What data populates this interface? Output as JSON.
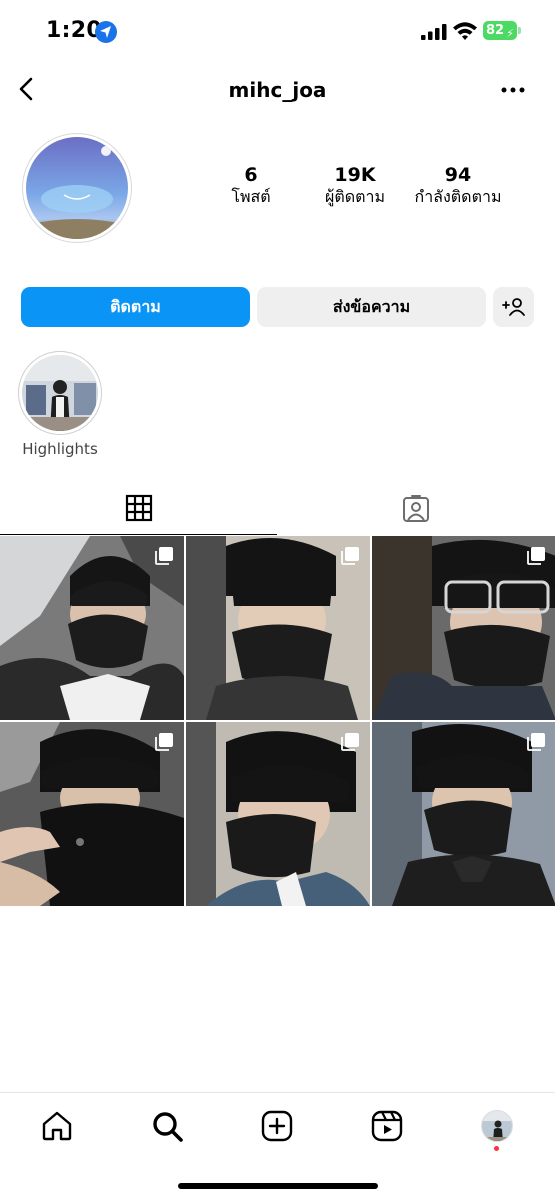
{
  "status_bar": {
    "time": "1:20",
    "battery": "82",
    "icons": [
      "location-arrow-icon",
      "cell-signal-icon",
      "wifi-icon",
      "battery-charging-icon"
    ]
  },
  "header": {
    "username": "mihc_joa",
    "back_icon": "chevron-left-icon",
    "more_icon": "more-horizontal-icon"
  },
  "profile": {
    "stats": [
      {
        "value": "6",
        "label": "โพสต์"
      },
      {
        "value": "19K",
        "label": "ผู้ติดตาม"
      },
      {
        "value": "94",
        "label": "กำลังติดตาม"
      }
    ]
  },
  "actions": {
    "follow_label": "ติดตาม",
    "message_label": "ส่งข้อความ",
    "suggest_icon": "add-person-icon"
  },
  "highlights": [
    {
      "label": "Highlights"
    }
  ],
  "tabs": [
    {
      "icon": "grid-icon",
      "active": true
    },
    {
      "icon": "tagged-icon",
      "active": false
    }
  ],
  "posts_count": 6,
  "bottom_nav": [
    "home-icon",
    "search-icon",
    "create-icon",
    "reels-icon",
    "profile-avatar"
  ],
  "colors": {
    "accent": "#0a95f6",
    "secondary_button": "#efefef",
    "battery": "#4cd964",
    "notification_dot": "#ff3040"
  }
}
